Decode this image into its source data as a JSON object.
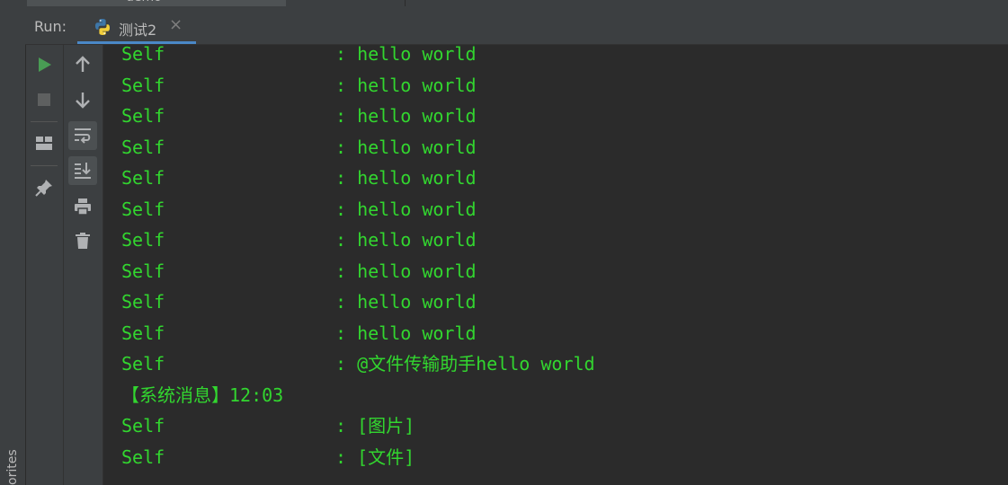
{
  "sidebar": {
    "favorites_label": "orites"
  },
  "top_tab": {
    "label": "demo"
  },
  "run_panel": {
    "label": "Run:",
    "tab_title": "测试2",
    "close_glyph": "×"
  },
  "toolbar": {
    "rerun_tooltip": "Rerun",
    "stop_tooltip": "Stop",
    "layout_tooltip": "Restore Layout",
    "pin_tooltip": "Pin Tab",
    "up_tooltip": "Up the Stack Trace",
    "down_tooltip": "Down the Stack Trace",
    "softwrap_tooltip": "Soft-Wrap",
    "scroll_end_tooltip": "Scroll to End",
    "print_tooltip": "Print",
    "clear_tooltip": "Clear All"
  },
  "colors": {
    "console_text": "#32d62f",
    "run_green": "#499c54",
    "accent": "#4a88c7"
  },
  "console": {
    "lines": [
      {
        "sender": "Self",
        "message": ": hello world"
      },
      {
        "sender": "Self",
        "message": ": hello world"
      },
      {
        "sender": "Self",
        "message": ": hello world"
      },
      {
        "sender": "Self",
        "message": ": hello world"
      },
      {
        "sender": "Self",
        "message": ": hello world"
      },
      {
        "sender": "Self",
        "message": ": hello world"
      },
      {
        "sender": "Self",
        "message": ": hello world"
      },
      {
        "sender": "Self",
        "message": ": hello world"
      },
      {
        "sender": "Self",
        "message": ": hello world"
      },
      {
        "sender": "Self",
        "message": ": hello world"
      },
      {
        "sender": "Self",
        "message": ": @文件传输助手hello world"
      },
      {
        "sender": "【系统消息】12:03",
        "message": ""
      },
      {
        "sender": "Self",
        "message": ": [图片]"
      },
      {
        "sender": "Self",
        "message": ": [文件]"
      }
    ]
  }
}
